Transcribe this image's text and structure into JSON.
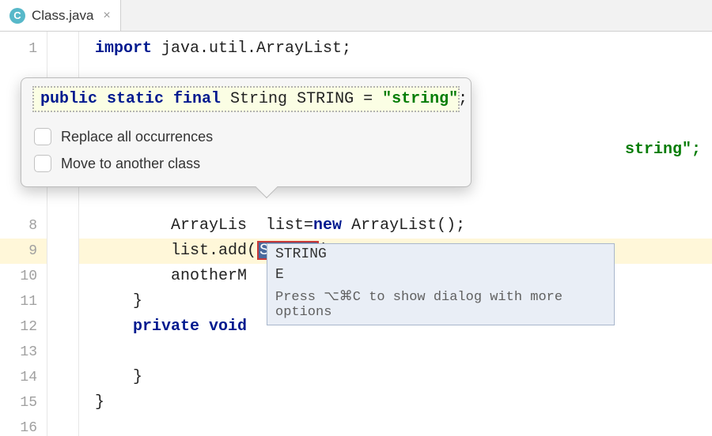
{
  "tab": {
    "icon_letter": "C",
    "filename": "Class.java",
    "close_glyph": "×"
  },
  "gutter_lines": [
    "1",
    "",
    "",
    "",
    "",
    "",
    "",
    "8",
    "9",
    "10",
    "11",
    "12",
    "13",
    "14",
    "15",
    "16"
  ],
  "code": {
    "line1_kw": "import",
    "line1_rest": " java.util.ArrayList;",
    "line_trailing_string": "string\";",
    "line8": "        ArrayLis  list=",
    "line8_kw": "new",
    "line8_after": " ArrayList();",
    "line9_pre": "        list.add(",
    "line9_token": "STRING",
    "line9_post": ");",
    "line10": "        anotherM",
    "line11": "    }",
    "line12_kw": "    private void",
    "line12_rest": "",
    "line14": "    }",
    "line15": "}"
  },
  "popup": {
    "decl_kw": "public static final",
    "decl_type": " String STRING = ",
    "decl_val": "\"string\"",
    "decl_end": ";",
    "opt1": "Replace all occurrences",
    "opt2": "Move to another class"
  },
  "suggest": {
    "item1": "STRING",
    "item2": "E",
    "hint": "Press ⌥⌘C to show dialog with more options"
  }
}
